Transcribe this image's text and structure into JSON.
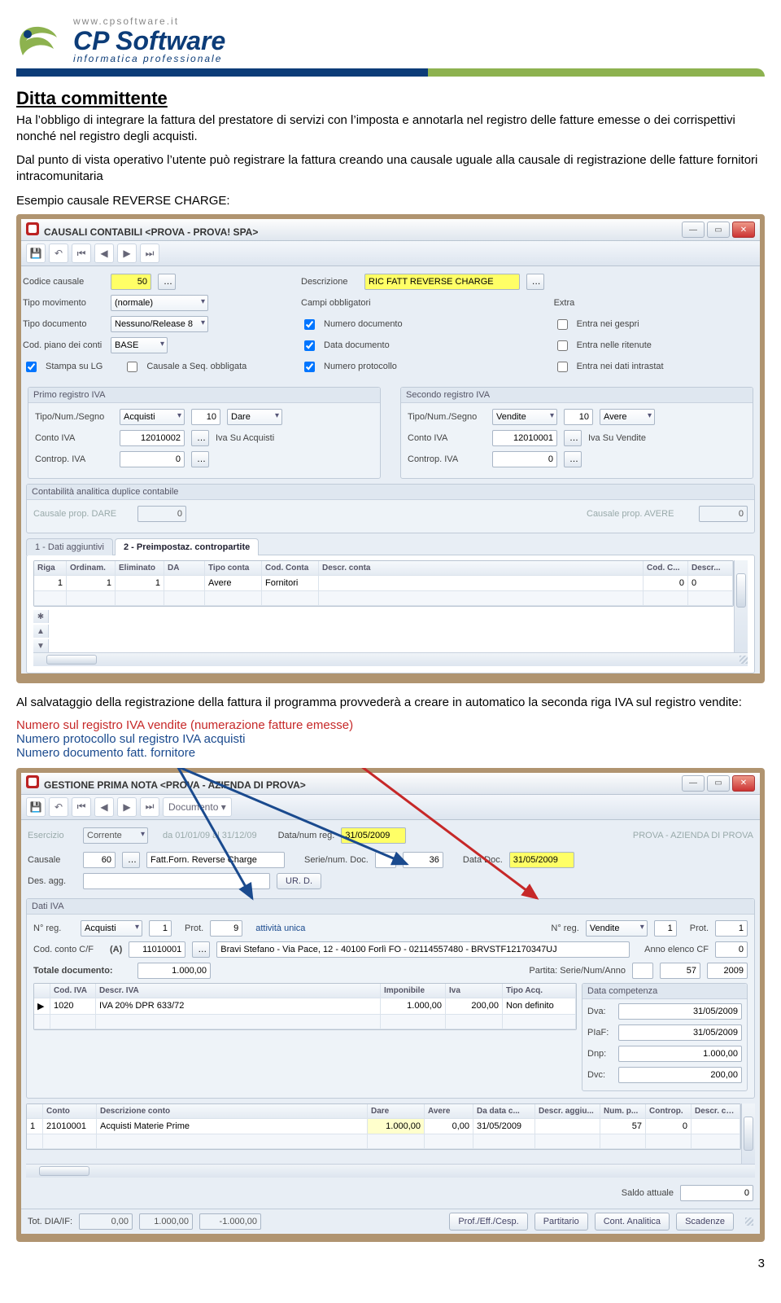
{
  "header": {
    "url": "www.cpsoftware.it",
    "brand": "CP Software",
    "tagline": "informatica professionale"
  },
  "section": {
    "title": "Ditta committente",
    "para1": "Ha l’obbligo di integrare la fattura del prestatore di servizi con l’imposta e annotarla nel registro delle fatture emesse o dei corrispettivi nonché nel registro degli acquisti.",
    "para2": "Dal punto di vista operativo l’utente può registrare la fattura creando una causale uguale alla causale di registrazione delle fatture fornitori intracomunitaria",
    "example_label": "Esempio causale REVERSE CHARGE:"
  },
  "win1": {
    "title": "CAUSALI CONTABILI <PROVA - PROVA! SPA>",
    "codice_causale_lbl": "Codice causale",
    "codice_causale_val": "50",
    "descrizione_lbl": "Descrizione",
    "descrizione_val": "RIC FATT REVERSE CHARGE",
    "tipo_mov_lbl": "Tipo movimento",
    "tipo_mov_val": "(normale)",
    "tipo_doc_lbl": "Tipo documento",
    "tipo_doc_val": "Nessuno/Release 8",
    "cod_piano_lbl": "Cod. piano dei conti",
    "cod_piano_val": "BASE",
    "stanpa_lbl": "Stampa su LG",
    "causale_seq_lbl": "Causale a Seq. obbligata",
    "campi_obb_lbl": "Campi obbligatori",
    "extra_lbl": "Extra",
    "cb_num_doc": "Numero documento",
    "cb_data_doc": "Data documento",
    "cb_num_prot": "Numero protocollo",
    "cb_entra_gespri": "Entra nei gespri",
    "cb_entra_rit": "Entra nelle ritenute",
    "cb_entra_intra": "Entra nei dati intrastat",
    "primo_lbl": "Primo registro IVA",
    "secondo_lbl": "Secondo registro IVA",
    "tns_lbl": "Tipo/Num./Segno",
    "primo_tipo": "Acquisti",
    "primo_num": "10",
    "primo_segno": "Dare",
    "sec_tipo": "Vendite",
    "sec_num": "10",
    "sec_segno": "Avere",
    "conto_iva_lbl": "Conto IVA",
    "primo_conto": "12010002",
    "primo_conto_desc": "Iva Su Acquisti",
    "sec_conto": "12010001",
    "sec_conto_desc": "Iva Su Vendite",
    "controp_lbl": "Controp. IVA",
    "zero": "0",
    "cont_an_lbl": "Contabilità analitica duplice contabile",
    "causale_dare_lbl": "Causale prop. DARE",
    "causale_avere_lbl": "Causale prop. AVERE",
    "tab1": "1 - Dati aggiuntivi",
    "tab2": "2 - Preimpostaz. contropartite",
    "gcols": [
      "Riga",
      "Ordinam.",
      "Eliminato",
      "DA",
      "Tipo conta",
      "Cod. Conta",
      "Descr. conta",
      "Cod. C...",
      "Descr..."
    ],
    "grow": [
      "1",
      "1",
      "1",
      "",
      "Avere",
      "Fornitori",
      "",
      "0",
      "0",
      ""
    ]
  },
  "middle": {
    "para": "Al salvataggio della registrazione della fattura il programma provvederà a creare in automatico la seconda riga IVA sul registro vendite:",
    "red": "Numero sul registro IVA vendite (numerazione fatture emesse)",
    "blue1": "Numero protocollo sul registro IVA acquisti",
    "blue2": "Numero documento fatt. fornitore"
  },
  "win2": {
    "title": "GESTIONE PRIMA NOTA <PROVA - AZIENDA DI PROVA>",
    "toolbar_doc": "Documento ▾",
    "esercizio_lbl": "Esercizio",
    "esercizio_val": "Corrente",
    "periodo": "da 01/01/09 al 31/12/09",
    "data_num_reg_lbl": "Data/num reg.",
    "data_reg": "31/05/2009",
    "azienda": "PROVA - AZIENDA DI PROVA",
    "causale_lbl": "Causale",
    "causale_cod": "60",
    "causale_desc": "Fatt.Forn. Reverse Charge",
    "serie_lbl": "Serie/num. Doc.",
    "serie_num": "36",
    "data_doc_lbl": "Data Doc.",
    "data_doc": "31/05/2009",
    "des_agg_lbl": "Des. agg.",
    "urd": "UR. D.",
    "dati_iva_hdr": "Dati IVA",
    "nreg_lbl": "N° reg.",
    "nreg_tipo": "Acquisti",
    "nreg_n": "1",
    "prot_lbl": "Prot.",
    "prot_n": "9",
    "attivita": "attività unica",
    "nreg2_tipo": "Vendite",
    "nreg2_n": "1",
    "prot2_lbl": "Prot.",
    "prot2_n": "1",
    "cod_conto_lbl": "Cod. conto C/F",
    "cf": "(A)",
    "cod_conto": "11010001",
    "anagrafica": "Bravi Stefano - Via Pace, 12 - 40100 Forlì FO - 02114557480 - BRVSTF12170347UJ",
    "anno_elenco_lbl": "Anno elenco CF",
    "anno_elenco": "0",
    "totale_lbl": "Totale documento:",
    "totale": "1.000,00",
    "partita_lbl": "Partita: Serie/Num/Anno",
    "partita_num": "57",
    "partita_anno": "2009",
    "iva_cols": [
      "",
      "Cod. IVA",
      "Descr. IVA",
      "Imponibile",
      "Iva",
      "Tipo Acq."
    ],
    "iva_row": [
      "▶",
      "1020",
      "IVA 20% DPR 633/72",
      "1.000,00",
      "200,00",
      "Non definito"
    ],
    "data_comp_hdr": "Data competenza",
    "dva_lbl": "Dva:",
    "dva": "31/05/2009",
    "piaf_lbl": "PIaF:",
    "piaf": "31/05/2009",
    "dnp_lbl": "Dnp:",
    "dnp": "1.000,00",
    "dvc_lbl": "Dvc:",
    "dvc": "200,00",
    "conti_cols": [
      "",
      "Conto",
      "Descrizione conto",
      "Dare",
      "Avere",
      "Da data c...",
      "Descr. aggiu...",
      "Num. p...",
      "Controp.",
      "Descr. co..."
    ],
    "conti_row": [
      "1",
      "21010001",
      "Acquisti Materie Prime",
      "1.000,00",
      "0,00",
      "31/05/2009",
      "",
      "57",
      "0",
      ""
    ],
    "saldo_lbl": "Saldo attuale",
    "saldo": "0",
    "foot_lbl": "Tot. DIA/IF:",
    "foot_v1": "0,00",
    "foot_v2": "1.000,00",
    "foot_v3": "-1.000,00",
    "btn1": "Prof./Eff./Cesp.",
    "btn2": "Partitario",
    "btn3": "Cont. Analitica",
    "btn4": "Scadenze"
  },
  "pagenum": "3"
}
